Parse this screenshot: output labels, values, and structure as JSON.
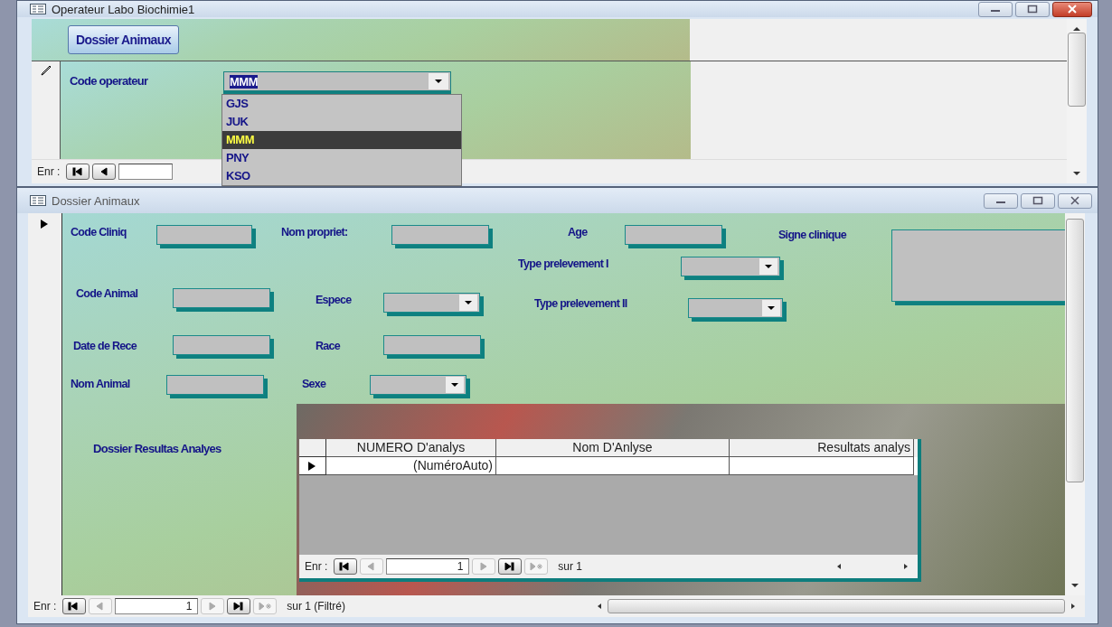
{
  "operator_window": {
    "title": "Operateur Labo Biochimie1",
    "header_button": "Dossier Animaux",
    "field_label": "Code operateur",
    "field_value": "MMM",
    "options": [
      {
        "label": "GJS",
        "selected": false
      },
      {
        "label": "JUK",
        "selected": false
      },
      {
        "label": "MMM",
        "selected": true
      },
      {
        "label": "PNY",
        "selected": false
      },
      {
        "label": "KSO",
        "selected": false
      }
    ],
    "nav": {
      "label": "Enr :",
      "buttons": [
        {
          "kind": "first",
          "disabled": false
        },
        {
          "kind": "prev",
          "disabled": false
        }
      ]
    }
  },
  "animal_window": {
    "title": "Dossier Animaux",
    "fields": [
      {
        "kind": "text",
        "label": "Code Cliniq"
      },
      {
        "kind": "text",
        "label": "Nom propriet:"
      },
      {
        "kind": "text",
        "label": "Age"
      },
      {
        "kind": "memo",
        "label": "Signe clinique"
      },
      {
        "kind": "combo",
        "label": "Type prelevement I"
      },
      {
        "kind": "text",
        "label": "Code Animal"
      },
      {
        "kind": "combo",
        "label": "Espece"
      },
      {
        "kind": "combo",
        "label": "Type prelevement II"
      },
      {
        "kind": "text",
        "label": "Date de Rece"
      },
      {
        "kind": "text",
        "label": "Race"
      },
      {
        "kind": "text",
        "label": "Nom Animal"
      },
      {
        "kind": "combo",
        "label": "Sexe"
      }
    ],
    "subform": {
      "label": "Dossier Resultas Analyes",
      "columns": [
        "NUMERO D'analys",
        "Nom D'Anlyse",
        "Resultats analys"
      ],
      "new_row_value": "(NuméroAuto)",
      "nav": {
        "label": "Enr :",
        "value": "1",
        "total": "sur  1",
        "buttons": [
          {
            "kind": "first",
            "disabled": false
          },
          {
            "kind": "prev",
            "disabled": true
          },
          {
            "kind": "field",
            "disabled": false
          },
          {
            "kind": "next",
            "disabled": true
          },
          {
            "kind": "last",
            "disabled": false
          },
          {
            "kind": "new",
            "disabled": true
          }
        ]
      }
    },
    "nav": {
      "label": "Enr :",
      "value": "1",
      "total": "sur  1 (Filtré)",
      "buttons": [
        {
          "kind": "first",
          "disabled": false
        },
        {
          "kind": "prev",
          "disabled": true
        },
        {
          "kind": "field",
          "disabled": false
        },
        {
          "kind": "next",
          "disabled": true
        },
        {
          "kind": "last",
          "disabled": false
        },
        {
          "kind": "new",
          "disabled": true
        }
      ]
    }
  }
}
